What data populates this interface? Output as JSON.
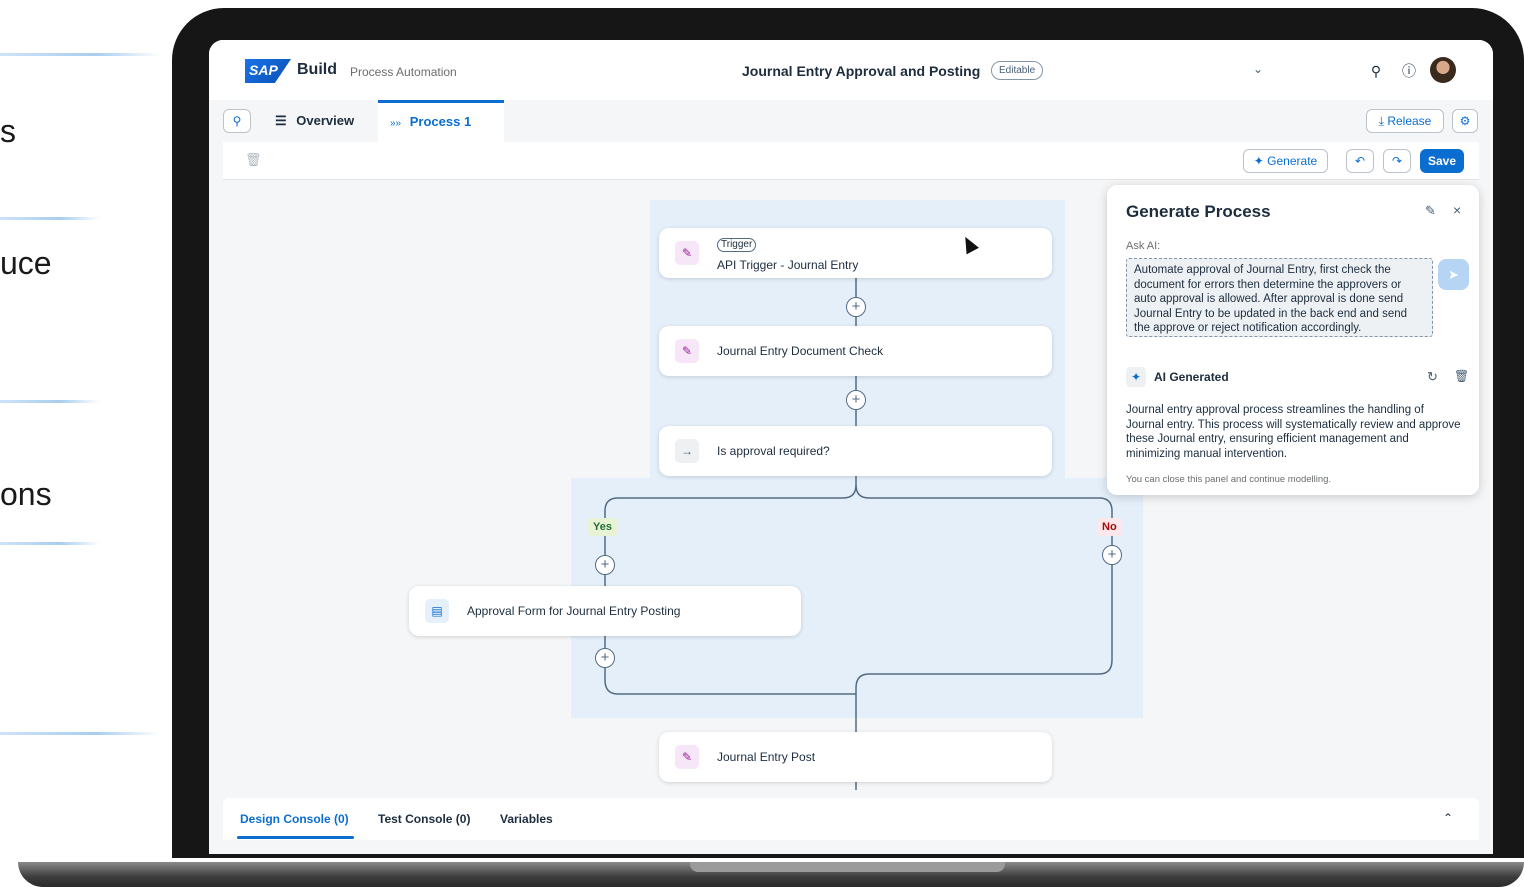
{
  "slide": {
    "fragments": [
      "s",
      "uce",
      "ons"
    ]
  },
  "shell": {
    "logo": "SAP",
    "brand": "Build",
    "product": "Process Automation",
    "title": "Journal Entry Approval and Posting",
    "badge": "Editable"
  },
  "tabs": {
    "overview": "Overview",
    "process": "Process 1"
  },
  "toolbar": {
    "release": "Release",
    "generate": "Generate",
    "save": "Save"
  },
  "flow": {
    "trigger_badge": "Trigger",
    "steps": [
      "API Trigger - Journal Entry",
      "Journal Entry Document Check",
      "Is approval required?",
      "Approval Form for Journal Entry Posting",
      "Journal Entry Post"
    ],
    "branch_yes": "Yes",
    "branch_no": "No"
  },
  "panel": {
    "title": "Generate Process",
    "ask_label": "Ask AI:",
    "prompt": "Automate approval of Journal Entry, first check the document for errors then determine the approvers or auto approval is allowed. After approval is done send Journal Entry to be updated in the back end and send the approve or reject notification accordingly.",
    "ai_title": "AI Generated",
    "ai_description": "Journal entry approval process streamlines the handling of Journal entry. This process will systematically review and approve these Journal entry, ensuring efficient management and minimizing manual intervention.",
    "note": "You can close this panel and continue modelling."
  },
  "console": {
    "design": "Design Console (0)",
    "test": "Test Console (0)",
    "variables": "Variables"
  },
  "colors": {
    "accent": "#0a6ed1",
    "lane": "#e4effa",
    "yes": "#256f3a",
    "no": "#aa0808"
  }
}
